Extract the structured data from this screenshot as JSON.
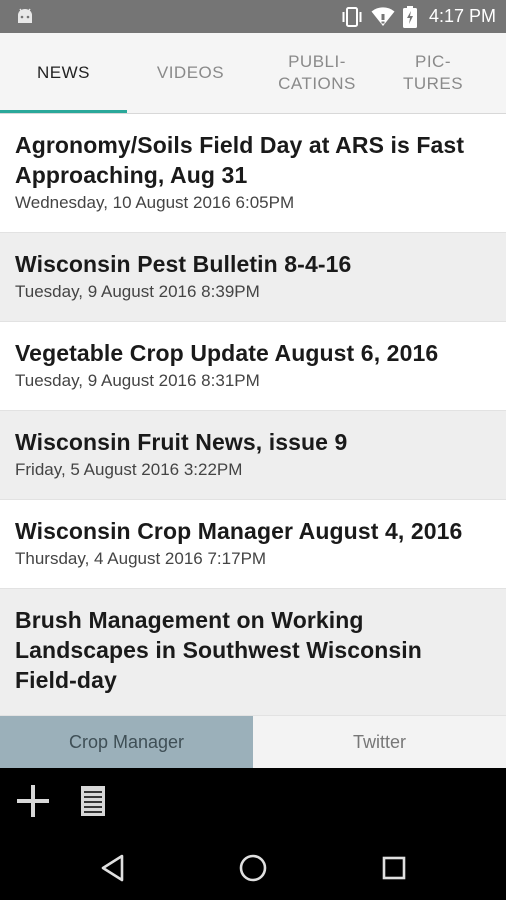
{
  "status_bar": {
    "time": "4:17 PM",
    "icons": [
      "android-icon",
      "vibrate-icon",
      "wifi-icon",
      "battery-icon"
    ]
  },
  "tabs": [
    {
      "label": "NEWS",
      "active": true
    },
    {
      "label": "VIDEOS",
      "active": false
    },
    {
      "label": "PUBLI-\nCATIONS",
      "active": false
    },
    {
      "label": "PIC-\nTURES",
      "active": false
    }
  ],
  "news": [
    {
      "title": "Agronomy/Soils Field Day at ARS is Fast Approaching, Aug 31",
      "date": "Wednesday, 10 August 2016 6:05PM"
    },
    {
      "title": "Wisconsin Pest Bulletin 8-4-16",
      "date": "Tuesday, 9 August 2016 8:39PM"
    },
    {
      "title": "Vegetable Crop Update August 6, 2016",
      "date": "Tuesday, 9 August 2016 8:31PM"
    },
    {
      "title": "Wisconsin Fruit News, issue 9",
      "date": "Friday, 5 August 2016 3:22PM"
    },
    {
      "title": "Wisconsin Crop Manager August 4, 2016",
      "date": "Thursday, 4 August 2016 7:17PM"
    },
    {
      "title": "Brush Management on Working Landscapes in Southwest Wisconsin Field-day",
      "date": ""
    }
  ],
  "bottom_tabs": [
    {
      "label": "Crop Manager",
      "active": true
    },
    {
      "label": "Twitter",
      "active": false
    }
  ],
  "colors": {
    "accent": "#2aa89a",
    "status_bar": "#757575",
    "bottom_tab_active": "#9bb0ba"
  }
}
